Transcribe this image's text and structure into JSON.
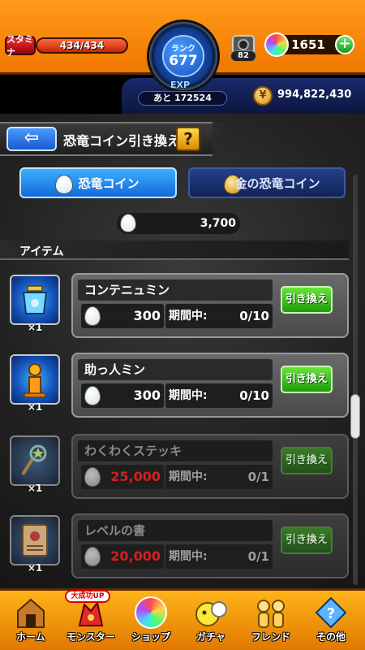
{
  "header": {
    "stamina_label": "スタミナ",
    "stamina_text": "434/434",
    "stamina_fraction": 1.0,
    "rank_label": "ランク",
    "rank_value": "677",
    "exp_label": "EXP",
    "exp_remaining": "あと 172524",
    "box_count": "82",
    "orb_count": "1651",
    "plus_label": "+",
    "coin_icon": "¥",
    "coin_total": "994,822,430"
  },
  "title_bar": {
    "back_label": "⇦",
    "title": "恐竜コイン引き換え",
    "help_label": "?"
  },
  "tabs": [
    {
      "label": "恐竜コイン",
      "active": true
    },
    {
      "label": "金の恐竜コイン",
      "active": false
    }
  ],
  "balance": {
    "value": "3,700"
  },
  "section": {
    "label": "アイテム"
  },
  "items": [
    {
      "name": "コンテニュミン",
      "qty": "×1",
      "cost": "300",
      "period_label": "期間中:",
      "period_value": "0/10",
      "button": "引き換え",
      "enabled": true
    },
    {
      "name": "助っ人ミン",
      "qty": "×1",
      "cost": "300",
      "period_label": "期間中:",
      "period_value": "0/10",
      "button": "引き換え",
      "enabled": true
    },
    {
      "name": "わくわくステッキ",
      "qty": "×1",
      "cost": "25,000",
      "period_label": "期間中:",
      "period_value": "0/1",
      "button": "引き換え",
      "enabled": false
    },
    {
      "name": "レベルの書",
      "qty": "×1",
      "cost": "20,000",
      "period_label": "期間中:",
      "period_value": "0/1",
      "button": "引き換え",
      "enabled": false
    }
  ],
  "bottom_nav": {
    "badge": "大成功UP",
    "items": [
      {
        "label": "ホーム",
        "icon": "home-icon"
      },
      {
        "label": "モンスター",
        "icon": "monster-icon"
      },
      {
        "label": "ショップ",
        "icon": "orb-icon"
      },
      {
        "label": "ガチャ",
        "icon": "gacha-icon"
      },
      {
        "label": "フレンド",
        "icon": "friends-icon"
      },
      {
        "label": "その他",
        "icon": "other-icon"
      }
    ]
  },
  "colors": {
    "header_orange": "#f07800",
    "accent_blue": "#1468d8",
    "button_green": "#1e9a10",
    "insufficient_red": "#d81e1e"
  }
}
